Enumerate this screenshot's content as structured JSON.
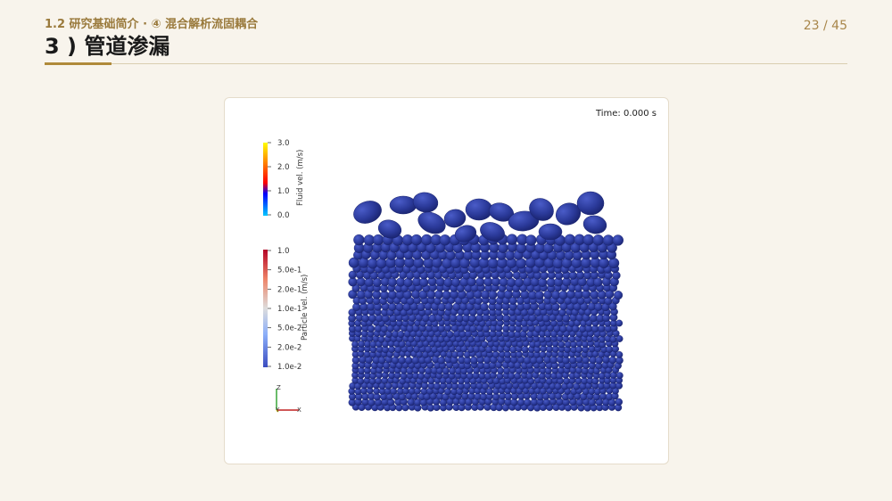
{
  "header": {
    "breadcrumb": "1.2 研究基础简介 · ④ 混合解析流固耦合",
    "title": "3 ) 管道渗漏",
    "page_number": "23 / 45"
  },
  "viewer": {
    "time_label": "Time: 0.000 s",
    "fluid_bar": {
      "title": "Fluid vel. (m/s)",
      "ticks": [
        "3.0",
        "2.0",
        "1.0",
        "0.0"
      ],
      "colors": [
        "#ffff00",
        "#ff8000",
        "#ff0000",
        "#0000ff",
        "#00c8ff"
      ]
    },
    "particle_bar": {
      "title": "Particle vel. (m/s)",
      "ticks": [
        "1.0",
        "5.0e-1",
        "2.0e-1",
        "1.0e-1",
        "5.0e-2",
        "2.0e-2",
        "1.0e-2"
      ],
      "colors": [
        "#b40426",
        "#ee8468",
        "#dddddd",
        "#8caff9",
        "#3b4cc0"
      ]
    },
    "axes": {
      "z": "Z",
      "y": "Y",
      "x": "X"
    },
    "particle_color": "#2b3a9a",
    "particle_dark": "#1a2470",
    "particle_light": "#4a5cc8"
  }
}
